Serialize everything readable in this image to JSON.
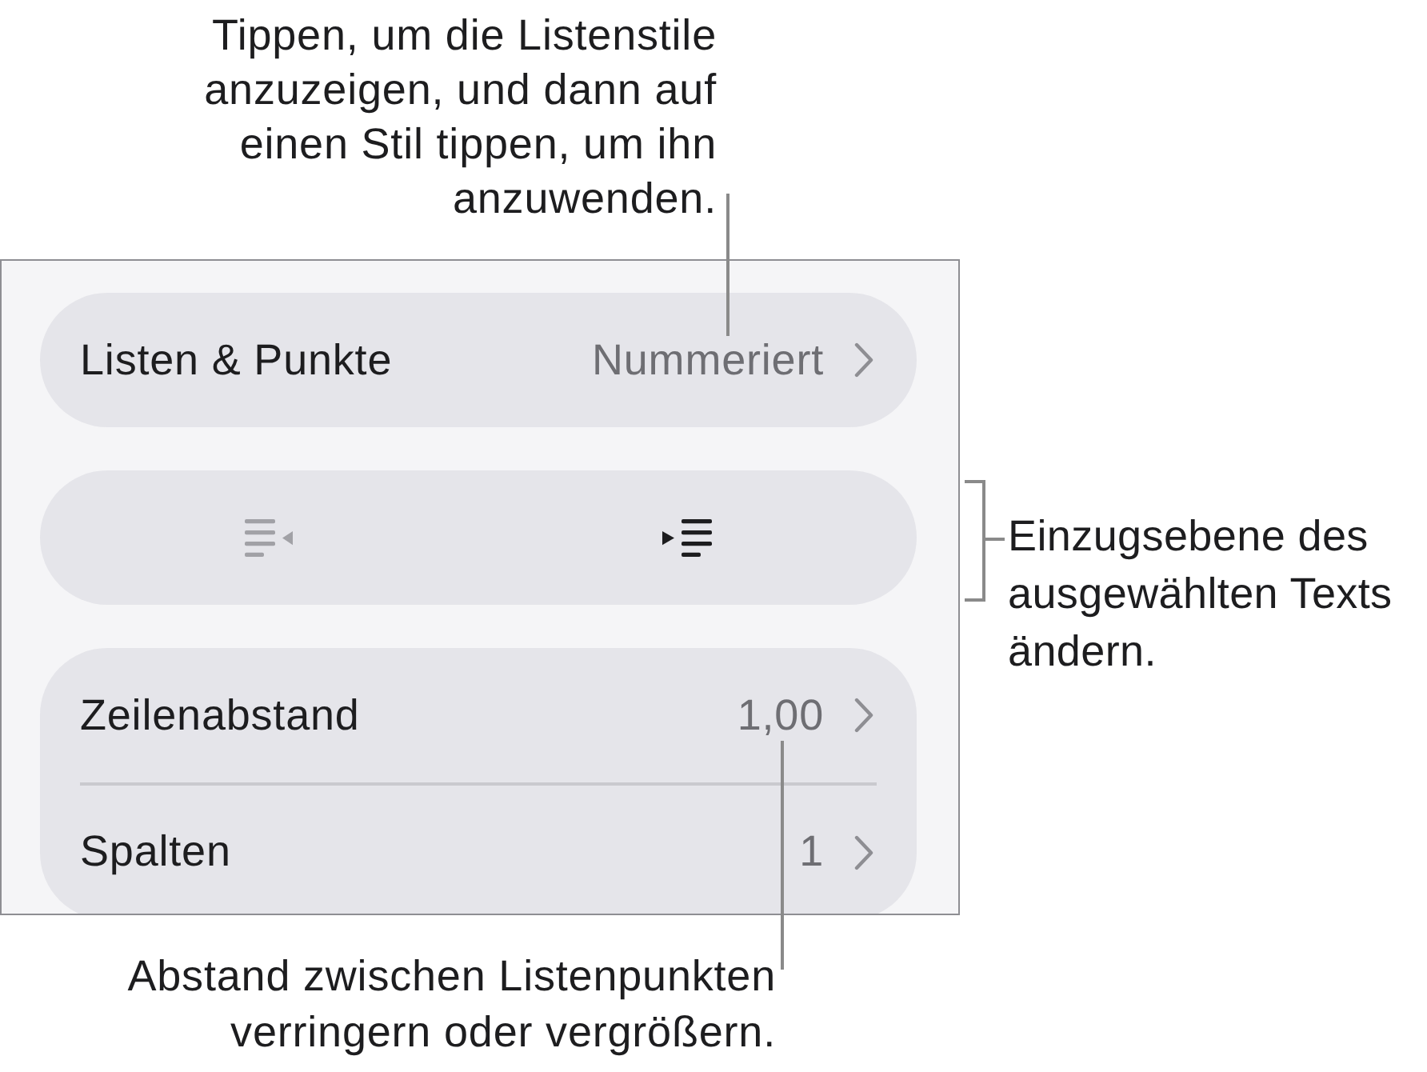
{
  "top_callout": {
    "text": "Tippen, um die Listenstile\nanzuzeigen, und dann auf\neinen Stil tippen, um ihn\nanzuwenden."
  },
  "panel": {
    "groups": [
      {
        "kind": "list",
        "rows": [
          {
            "label": "Listen & Punkte",
            "value": "Nummeriert"
          }
        ]
      },
      {
        "kind": "buttons",
        "buttons": [
          {
            "kind": "outdent",
            "disabled": true
          },
          {
            "kind": "indent",
            "disabled": false
          }
        ]
      },
      {
        "kind": "list",
        "rows": [
          {
            "label": "Zeilenabstand",
            "value": "1,00"
          },
          {
            "label": "Spalten",
            "value": "1"
          }
        ]
      }
    ]
  },
  "right_callout": {
    "text": "Einzugsebene des\nausgewählten Texts\nändern."
  },
  "bottom_callout": {
    "text": "Abstand zwischen Listenpunkten\nverringern oder vergrößern."
  }
}
